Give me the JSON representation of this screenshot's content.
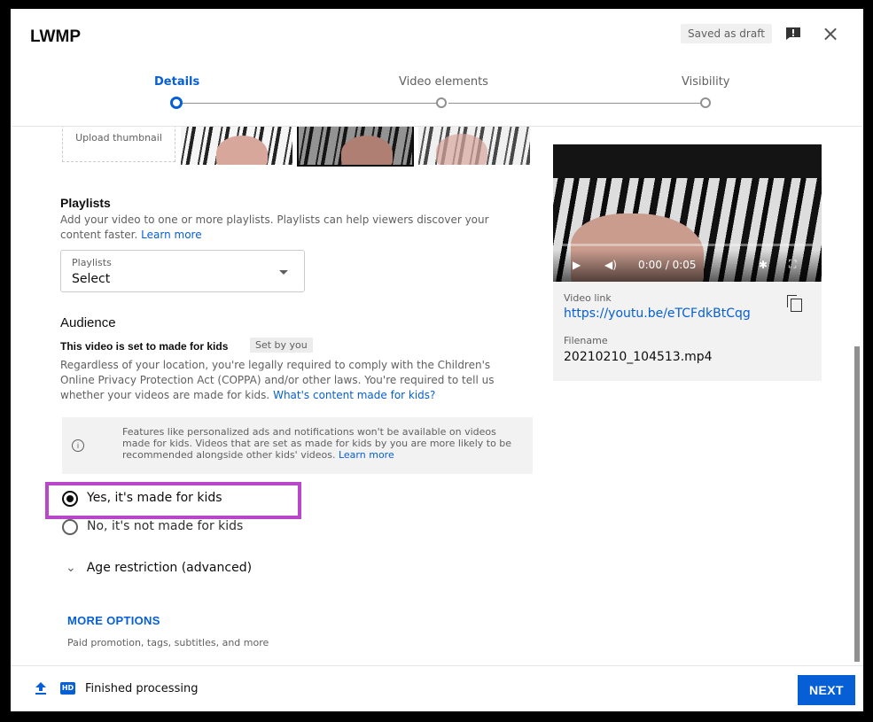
{
  "dialog": {
    "title": "LWMP",
    "saved_status": "Saved as draft"
  },
  "icons": {
    "feedback": "feedback-icon",
    "close": "close-icon",
    "upload": "upload-icon",
    "hd": "hd-icon",
    "info": "info-icon",
    "copy": "copy-icon"
  },
  "stepper": {
    "steps": [
      {
        "label": "Details",
        "active": true
      },
      {
        "label": "Video elements",
        "active": false
      },
      {
        "label": "Visibility",
        "active": false
      }
    ]
  },
  "thumbnail": {
    "upload_label": "Upload thumbnail"
  },
  "playlists": {
    "heading": "Playlists",
    "description": "Add your video to one or more playlists. Playlists can help viewers discover your content faster.",
    "learn_more": "Learn more",
    "select_label": "Playlists",
    "select_value": "Select"
  },
  "audience": {
    "heading": "Audience",
    "set_line": "This video is set to made for kids",
    "set_badge": "Set by you",
    "description": "Regardless of your location, you're legally required to comply with the Children's Online Privacy Protection Act (COPPA) and/or other laws. You're required to tell us whether your videos are made for kids.",
    "what_link": "What's content made for kids?",
    "info_text": "Features like personalized ads and notifications won't be available on videos made for kids. Videos that are set as made for kids by you are more likely to be recommended alongside other kids' videos.",
    "info_link": "Learn more",
    "option_yes": "Yes, it's made for kids",
    "option_no": "No, it's not made for kids",
    "selected": "yes"
  },
  "age_restriction": {
    "label": "Age restriction (advanced)"
  },
  "more_options": {
    "label": "MORE OPTIONS",
    "sub": "Paid promotion, tags, subtitles, and more"
  },
  "preview": {
    "time": "0:00 / 0:05",
    "video_link_label": "Video link",
    "video_link": "https://youtu.be/eTCFdkBtCqg",
    "filename_label": "Filename",
    "filename": "20210210_104513.mp4"
  },
  "footer": {
    "status": "Finished processing",
    "hd_badge": "HD",
    "next_label": "NEXT"
  },
  "colors": {
    "accent": "#065fd4",
    "highlight": "#b847c9"
  }
}
